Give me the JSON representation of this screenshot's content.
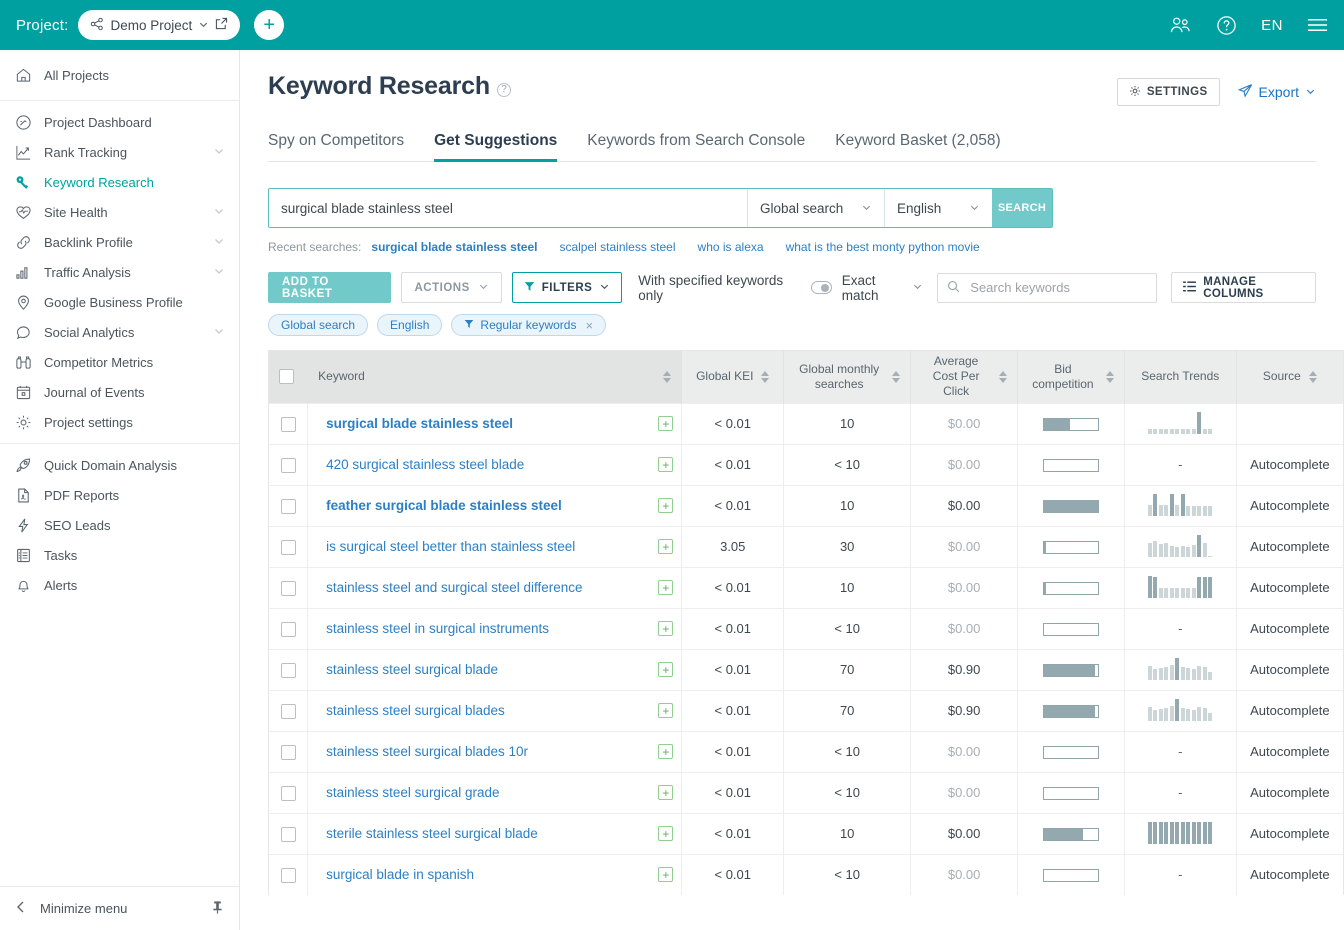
{
  "topbar": {
    "project_label": "Project:",
    "project_name": "Demo Project",
    "add_label": "+",
    "lang": "EN",
    "icons": [
      "users-icon",
      "help-icon",
      "language",
      "hamburger-menu-icon"
    ]
  },
  "sidebar": {
    "top": [
      {
        "label": "All Projects",
        "icon": "home-icon",
        "expandable": false
      }
    ],
    "items": [
      {
        "label": "Project Dashboard",
        "icon": "dashboard-icon",
        "expandable": false,
        "active": false
      },
      {
        "label": "Rank Tracking",
        "icon": "rank-chart-icon",
        "expandable": true,
        "active": false
      },
      {
        "label": "Keyword Research",
        "icon": "key-icon",
        "expandable": false,
        "active": true
      },
      {
        "label": "Site Health",
        "icon": "heartbeat-icon",
        "expandable": true,
        "active": false
      },
      {
        "label": "Backlink Profile",
        "icon": "link-icon",
        "expandable": true,
        "active": false
      },
      {
        "label": "Traffic Analysis",
        "icon": "bar-chart-icon",
        "expandable": true,
        "active": false
      },
      {
        "label": "Google Business Profile",
        "icon": "map-pin-icon",
        "expandable": false,
        "active": false
      },
      {
        "label": "Social Analytics",
        "icon": "chat-bubble-icon",
        "expandable": true,
        "active": false
      },
      {
        "label": "Competitor Metrics",
        "icon": "binoculars-icon",
        "expandable": false,
        "active": false
      },
      {
        "label": "Journal of Events",
        "icon": "calendar-icon",
        "expandable": false,
        "active": false
      },
      {
        "label": "Project settings",
        "icon": "gear-icon",
        "expandable": false,
        "active": false
      }
    ],
    "tools": [
      {
        "label": "Quick Domain Analysis",
        "icon": "rocket-icon"
      },
      {
        "label": "PDF Reports",
        "icon": "pdf-file-icon"
      },
      {
        "label": "SEO Leads",
        "icon": "lightning-bolt-icon"
      },
      {
        "label": "Tasks",
        "icon": "checklist-icon"
      },
      {
        "label": "Alerts",
        "icon": "bell-icon"
      }
    ],
    "footer": {
      "label": "Minimize menu",
      "icon": "chevron-left-icon",
      "pin_icon": "pin-icon"
    }
  },
  "page": {
    "title": "Keyword Research",
    "help_icon": "question-mark-icon",
    "settings_label": "SETTINGS",
    "export_label": "Export"
  },
  "tabs": [
    {
      "label": "Spy on Competitors",
      "active": false
    },
    {
      "label": "Get Suggestions",
      "active": true
    },
    {
      "label": "Keywords from Search Console",
      "active": false
    },
    {
      "label": "Keyword Basket (2,058)",
      "active": false
    }
  ],
  "search": {
    "value": "surgical blade stainless steel",
    "placeholder": "",
    "scope": "Global search",
    "language": "English",
    "button": "SEARCH"
  },
  "recent": {
    "label": "Recent searches:",
    "items": [
      {
        "text": "surgical blade stainless steel",
        "bold": true
      },
      {
        "text": "scalpel stainless steel",
        "bold": false
      },
      {
        "text": "who is alexa",
        "bold": false
      },
      {
        "text": "what is the best monty python movie",
        "bold": false
      }
    ]
  },
  "toolbar": {
    "add_to_basket": "ADD TO BASKET",
    "actions": "ACTIONS",
    "filters": "FILTERS",
    "specified_only": "With specified keywords only",
    "toggle_on": false,
    "exact_match": "Exact match",
    "search_placeholder": "Search keywords",
    "search_value": "",
    "manage_columns": "MANAGE COLUMNS"
  },
  "chips": [
    {
      "label": "Global search",
      "removable": false,
      "filter_icon": false
    },
    {
      "label": "English",
      "removable": false,
      "filter_icon": false
    },
    {
      "label": "Regular keywords",
      "removable": true,
      "filter_icon": true
    }
  ],
  "table": {
    "columns": [
      {
        "key": "checkbox",
        "label": "",
        "sortable": false
      },
      {
        "key": "keyword",
        "label": "Keyword",
        "sortable": true
      },
      {
        "key": "kei",
        "label": "Global KEI",
        "sortable": true
      },
      {
        "key": "gms",
        "label": "Global monthly searches",
        "sortable": true
      },
      {
        "key": "cpc",
        "label": "Average Cost Per Click",
        "sortable": true
      },
      {
        "key": "bid",
        "label": "Bid competition",
        "sortable": true
      },
      {
        "key": "trends",
        "label": "Search Trends",
        "sortable": false
      },
      {
        "key": "source",
        "label": "Source",
        "sortable": true
      }
    ],
    "rows": [
      {
        "keyword": "surgical blade stainless steel",
        "bold": true,
        "kei": "< 0.01",
        "gms": "10",
        "cpc": "$0.00",
        "cpc_zero": true,
        "bid": 48,
        "trends": [
          22,
          22,
          22,
          22,
          22,
          22,
          22,
          22,
          22,
          100,
          22,
          22
        ],
        "trend_hi": [
          9
        ],
        "source": ""
      },
      {
        "keyword": "420 surgical stainless steel blade",
        "bold": false,
        "kei": "< 0.01",
        "gms": "< 10",
        "cpc": "$0.00",
        "cpc_zero": true,
        "bid": 0,
        "trends": [],
        "trend_hi": [],
        "source": "Autocomplete"
      },
      {
        "keyword": "feather surgical blade stainless steel",
        "bold": true,
        "kei": "< 0.01",
        "gms": "10",
        "cpc": "$0.00",
        "cpc_zero": false,
        "bid": 100,
        "trends": [
          50,
          100,
          48,
          48,
          100,
          48,
          100,
          46,
          46,
          46,
          46,
          46
        ],
        "trend_hi": [
          1,
          4,
          6
        ],
        "source": "Autocomplete"
      },
      {
        "keyword": "is surgical steel better than stainless steel",
        "bold": false,
        "kei": "3.05",
        "gms": "30",
        "cpc": "$0.00",
        "cpc_zero": true,
        "bid": 4,
        "trends": [
          62,
          72,
          58,
          62,
          48,
          44,
          52,
          44,
          56,
          100,
          62,
          0
        ],
        "trend_hi": [
          9
        ],
        "source": "Autocomplete"
      },
      {
        "keyword": "stainless steel and surgical steel difference",
        "bold": false,
        "kei": "< 0.01",
        "gms": "10",
        "cpc": "$0.00",
        "cpc_zero": true,
        "bid": 4,
        "trends": [
          100,
          96,
          44,
          44,
          44,
          44,
          44,
          44,
          44,
          96,
          96,
          96
        ],
        "trend_hi": [
          0,
          1,
          9,
          10,
          11
        ],
        "source": "Autocomplete"
      },
      {
        "keyword": "stainless steel in surgical instruments",
        "bold": false,
        "kei": "< 0.01",
        "gms": "< 10",
        "cpc": "$0.00",
        "cpc_zero": true,
        "bid": 0,
        "trends": [],
        "trend_hi": [],
        "source": "Autocomplete"
      },
      {
        "keyword": "stainless steel surgical blade",
        "bold": false,
        "kei": "< 0.01",
        "gms": "70",
        "cpc": "$0.90",
        "cpc_zero": false,
        "bid": 94,
        "trends": [
          62,
          48,
          54,
          58,
          70,
          100,
          58,
          56,
          52,
          62,
          58,
          36
        ],
        "trend_hi": [
          5
        ],
        "source": "Autocomplete"
      },
      {
        "keyword": "stainless steel surgical blades",
        "bold": false,
        "kei": "< 0.01",
        "gms": "70",
        "cpc": "$0.90",
        "cpc_zero": false,
        "bid": 94,
        "trends": [
          62,
          48,
          54,
          58,
          70,
          100,
          58,
          56,
          52,
          62,
          58,
          36
        ],
        "trend_hi": [
          5
        ],
        "source": "Autocomplete"
      },
      {
        "keyword": "stainless steel surgical blades 10r",
        "bold": false,
        "kei": "< 0.01",
        "gms": "< 10",
        "cpc": "$0.00",
        "cpc_zero": true,
        "bid": 0,
        "trends": [],
        "trend_hi": [],
        "source": "Autocomplete"
      },
      {
        "keyword": "stainless steel surgical grade",
        "bold": false,
        "kei": "< 0.01",
        "gms": "< 10",
        "cpc": "$0.00",
        "cpc_zero": true,
        "bid": 0,
        "trends": [],
        "trend_hi": [],
        "source": "Autocomplete"
      },
      {
        "keyword": "sterile stainless steel surgical blade",
        "bold": false,
        "kei": "< 0.01",
        "gms": "10",
        "cpc": "$0.00",
        "cpc_zero": false,
        "bid": 72,
        "trends": [
          100,
          100,
          100,
          100,
          100,
          100,
          100,
          100,
          100,
          100,
          100,
          100
        ],
        "trend_hi": [
          0,
          1,
          2,
          3,
          4,
          5,
          6,
          7,
          8,
          9,
          10,
          11
        ],
        "source": "Autocomplete"
      },
      {
        "keyword": "surgical blade in spanish",
        "bold": false,
        "kei": "< 0.01",
        "gms": "< 10",
        "cpc": "$0.00",
        "cpc_zero": true,
        "bid": 0,
        "trends": [],
        "trend_hi": [],
        "source": "Autocomplete"
      }
    ],
    "empty_marker": "-"
  },
  "colors": {
    "brand": "#00A0A0",
    "brand_light": "#72c9c9",
    "link": "#2c7fc4",
    "bar": "#93a8af",
    "bar_light": "#ccd6d9"
  }
}
